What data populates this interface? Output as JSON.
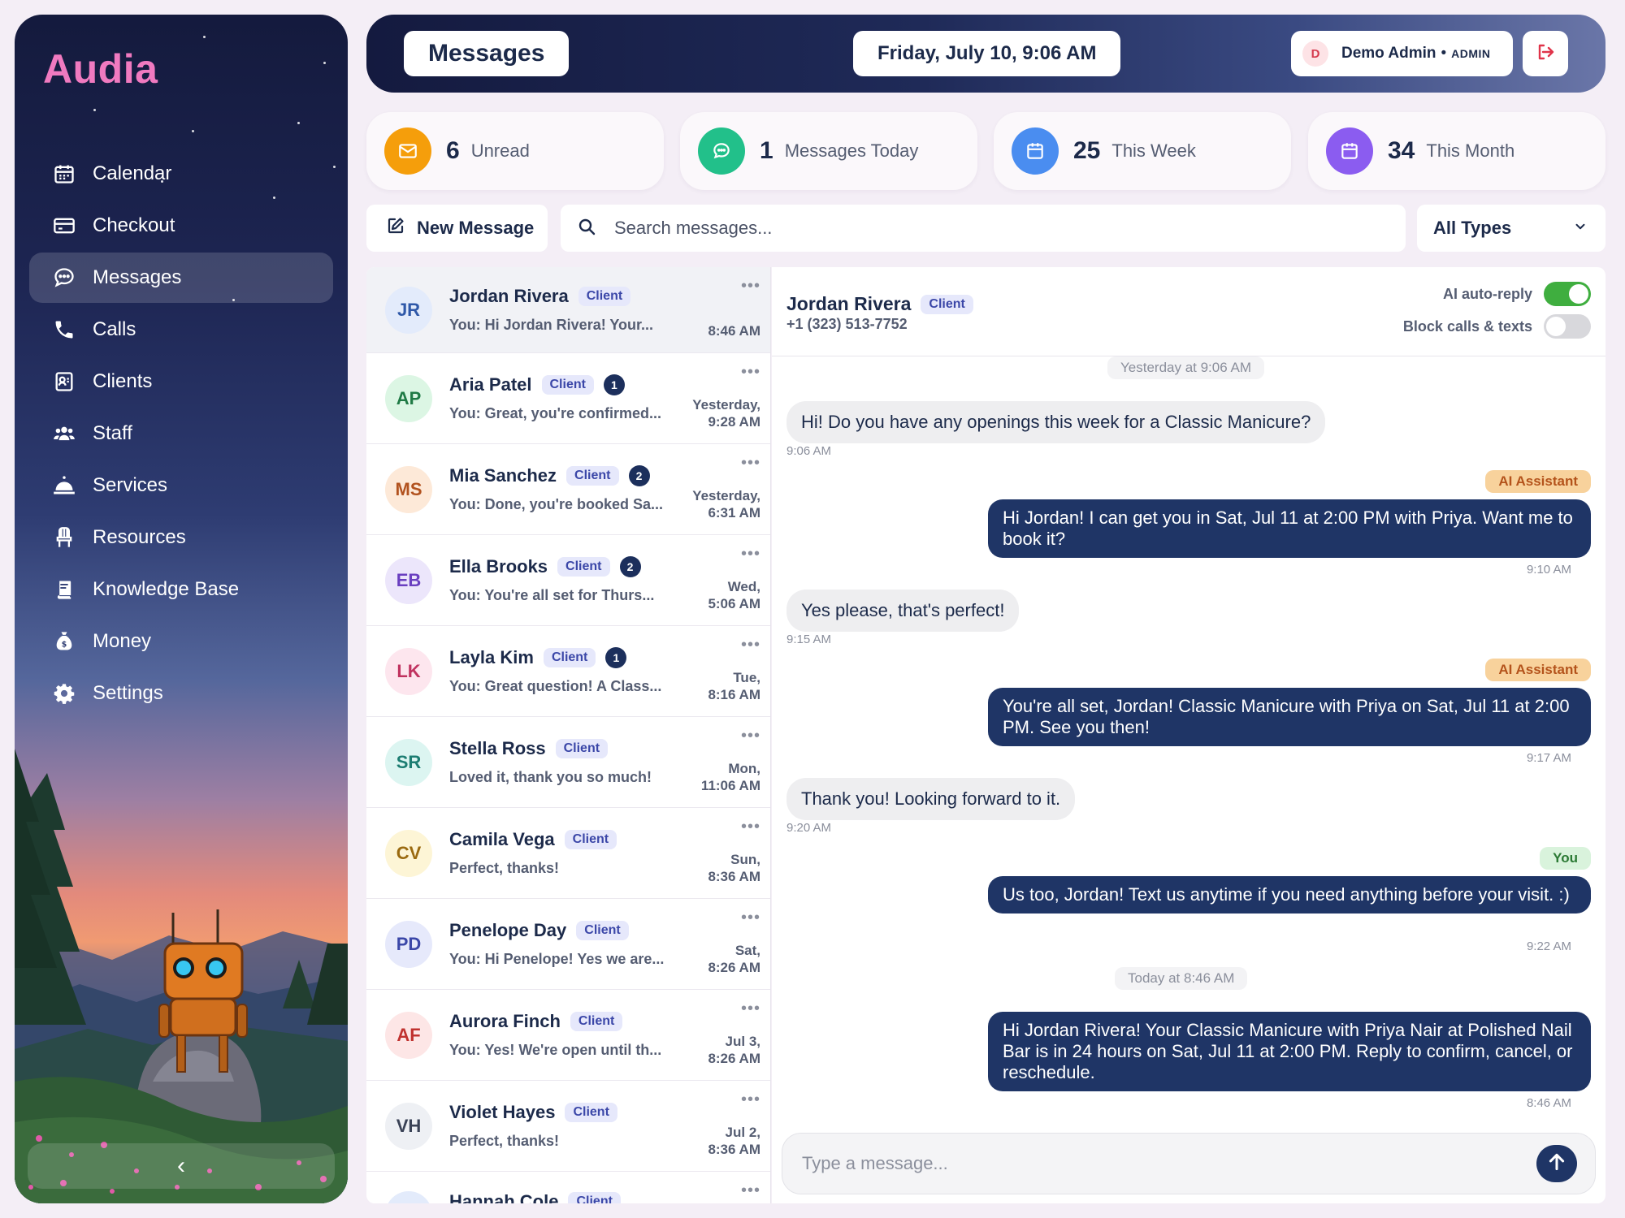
{
  "sidebar": {
    "brand": "Audia",
    "items": [
      {
        "label": "Calendar",
        "icon": "calendar-icon"
      },
      {
        "label": "Checkout",
        "icon": "credit-card-icon"
      },
      {
        "label": "Messages",
        "icon": "chat-bubble-icon",
        "active": true
      },
      {
        "label": "Calls",
        "icon": "phone-icon"
      },
      {
        "label": "Clients",
        "icon": "contact-card-icon"
      },
      {
        "label": "Staff",
        "icon": "users-icon"
      },
      {
        "label": "Services",
        "icon": "service-bell-icon"
      },
      {
        "label": "Resources",
        "icon": "chair-icon"
      },
      {
        "label": "Knowledge Base",
        "icon": "book-icon"
      },
      {
        "label": "Money",
        "icon": "money-bag-icon"
      },
      {
        "label": "Settings",
        "icon": "gear-icon"
      }
    ],
    "collapse_glyph": "‹"
  },
  "header": {
    "title": "Messages",
    "datetime": "Friday, July 10, 9:06 AM",
    "user": {
      "initial": "D",
      "name": "Demo Admin",
      "separator": "•",
      "role": "ADMIN"
    }
  },
  "stats": [
    {
      "value": "6",
      "label": "Unread",
      "icon": "envelope-icon",
      "color": "#f59e0b"
    },
    {
      "value": "1",
      "label": "Messages Today",
      "icon": "chat-bubble-icon",
      "color": "#22c08a"
    },
    {
      "value": "25",
      "label": "This Week",
      "icon": "calendar-icon",
      "color": "#4a8df0"
    },
    {
      "value": "34",
      "label": "This Month",
      "icon": "calendar-icon",
      "color": "#8b5cf0"
    }
  ],
  "toolbar": {
    "new_message_label": "New Message",
    "search_placeholder": "Search messages...",
    "filter_value": "All Types"
  },
  "conversations": [
    {
      "initials": "JR",
      "name": "Jordan Rivera",
      "badge": "Client",
      "count": "",
      "preview": "You: Hi Jordan Rivera! Your...",
      "time": [
        "8:46 AM"
      ],
      "bg": "#e3ebfb",
      "fg": "#2f58a8"
    },
    {
      "initials": "AP",
      "name": "Aria Patel",
      "badge": "Client",
      "count": "1",
      "preview": "You: Great, you're confirmed...",
      "time": [
        "Yesterday,",
        "9:28 AM"
      ],
      "bg": "#dcf6e4",
      "fg": "#1f7a45"
    },
    {
      "initials": "MS",
      "name": "Mia Sanchez",
      "badge": "Client",
      "count": "2",
      "preview": "You: Done, you're booked Sa...",
      "time": [
        "Yesterday,",
        "6:31 AM"
      ],
      "bg": "#fde9d8",
      "fg": "#b2521e"
    },
    {
      "initials": "EB",
      "name": "Ella Brooks",
      "badge": "Client",
      "count": "2",
      "preview": "You: You're all set for Thurs...",
      "time": [
        "Wed,",
        "5:06 AM"
      ],
      "bg": "#ece6fb",
      "fg": "#6a3fc0"
    },
    {
      "initials": "LK",
      "name": "Layla Kim",
      "badge": "Client",
      "count": "1",
      "preview": "You: Great question! A Class...",
      "time": [
        "Tue,",
        "8:16 AM"
      ],
      "bg": "#fde6ee",
      "fg": "#c0325f"
    },
    {
      "initials": "SR",
      "name": "Stella Ross",
      "badge": "Client",
      "count": "",
      "preview": "Loved it, thank you so much!",
      "time": [
        "Mon,",
        "11:06 AM"
      ],
      "bg": "#dcf5f1",
      "fg": "#1c7d72"
    },
    {
      "initials": "CV",
      "name": "Camila Vega",
      "badge": "Client",
      "count": "",
      "preview": "Perfect, thanks!",
      "time": [
        "Sun,",
        "8:36 AM"
      ],
      "bg": "#fdf5d6",
      "fg": "#9a6a10"
    },
    {
      "initials": "PD",
      "name": "Penelope Day",
      "badge": "Client",
      "count": "",
      "preview": "You: Hi Penelope! Yes we are...",
      "time": [
        "Sat,",
        "8:26 AM"
      ],
      "bg": "#e6e9fb",
      "fg": "#3b47a8"
    },
    {
      "initials": "AF",
      "name": "Aurora Finch",
      "badge": "Client",
      "count": "",
      "preview": "You: Yes! We're open until th...",
      "time": [
        "Jul 3,",
        "8:26 AM"
      ],
      "bg": "#fde6e6",
      "fg": "#c0322f"
    },
    {
      "initials": "VH",
      "name": "Violet Hayes",
      "badge": "Client",
      "count": "",
      "preview": "Perfect, thanks!",
      "time": [
        "Jul 2,",
        "8:36 AM"
      ],
      "bg": "#eef0f4",
      "fg": "#3a4256"
    },
    {
      "initials": "HC",
      "name": "Hannah Cole",
      "badge": "Client",
      "count": "",
      "preview": "",
      "time": [
        "",
        ""
      ],
      "bg": "#e3ebfb",
      "fg": "#2f58a8"
    }
  ],
  "chat": {
    "name": "Jordan Rivera",
    "badge": "Client",
    "phone": "+1 (323) 513-7752",
    "ai_autoreply_label": "AI auto-reply",
    "block_label": "Block calls & texts",
    "day1": "Yesterday at 9:06 AM",
    "day2": "Today at 8:46 AM",
    "messages": [
      {
        "dir": "in",
        "text": "Hi! Do you have any openings this week for a Classic Manicure?",
        "time": "9:06 AM"
      },
      {
        "dir": "out",
        "tag": "AI Assistant",
        "text": "Hi Jordan! I can get you in Sat, Jul 11 at 2:00 PM with Priya. Want me to book it?",
        "time": "9:10 AM"
      },
      {
        "dir": "in",
        "text": "Yes please, that's perfect!",
        "time": "9:15 AM"
      },
      {
        "dir": "out",
        "tag": "AI Assistant",
        "text": "You're all set, Jordan! Classic Manicure with Priya on Sat, Jul 11 at 2:00 PM. See you then!",
        "time": "9:17 AM"
      },
      {
        "dir": "in",
        "text": "Thank you! Looking forward to it.",
        "time": "9:20 AM"
      },
      {
        "dir": "out",
        "tag": "You",
        "text": "Us too, Jordan! Text us anytime if you need anything before your visit. :)",
        "time": "9:22 AM"
      },
      {
        "dir": "out",
        "tag": "",
        "text": "Hi Jordan Rivera! Your Classic Manicure with Priya Nair at Polished Nail Bar is in 24 hours on Sat, Jul 11 at 2:00 PM. Reply to confirm, cancel, or reschedule.",
        "time": "8:46 AM"
      }
    ],
    "composer_placeholder": "Type a message..."
  }
}
